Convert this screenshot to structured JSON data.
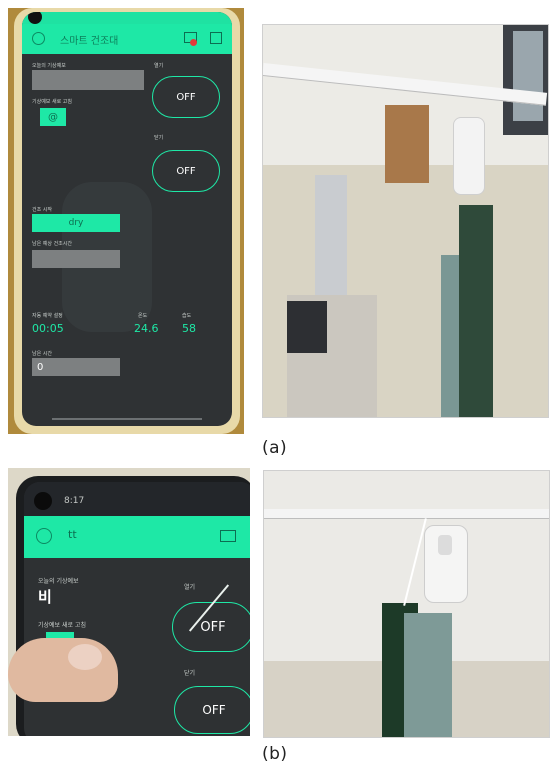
{
  "captions": {
    "a": "(a)",
    "b": "(b)"
  },
  "phone_a": {
    "title": "스마트 건조대",
    "weather_label": "오늘의 기상예보",
    "refresh_label": "기상예보 새로 고침",
    "refresh_symbol": "@",
    "open_label": "열기",
    "open_state": "OFF",
    "close_label": "닫기",
    "close_state": "OFF",
    "dry_start_label": "건조 시작",
    "dry_button": "dry",
    "remaining_label": "남은 예상 건조시간",
    "auto_label": "자동 예약 설정",
    "auto_value": "00:05",
    "temp_label": "온도",
    "temp_value": "24.6",
    "humidity_label": "습도",
    "humidity_value": "58",
    "remain_time_label": "남은 시간",
    "remain_time_value": "0"
  },
  "phone_b": {
    "status_time": "8:17",
    "title": "tt",
    "weather_label": "오늘의 기상예보",
    "weather_value": "비",
    "refresh_label": "기상예보 새로 고침",
    "refresh_symbol": "@",
    "open_label": "열기",
    "open_state": "OFF",
    "close_label": "닫기",
    "close_state": "OFF"
  }
}
